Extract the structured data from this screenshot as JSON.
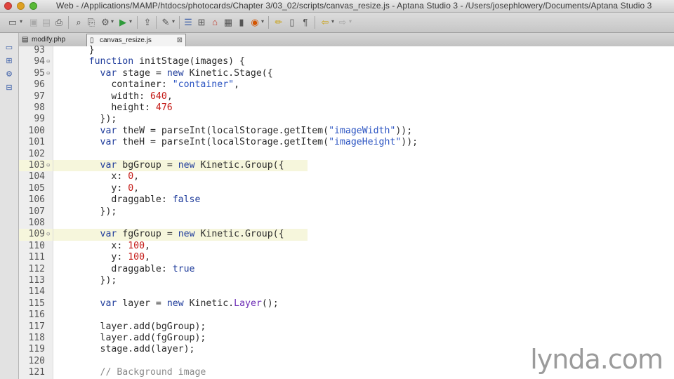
{
  "window": {
    "title": "Web - /Applications/MAMP/htdocs/photocards/Chapter 3/03_02/scripts/canvas_resize.js - Aptana Studio 3 - /Users/josephlowery/Documents/Aptana Studio 3"
  },
  "tabs": [
    {
      "label": "modify.php",
      "active": false
    },
    {
      "label": "canvas_resize.js",
      "active": true,
      "close": "⊠"
    }
  ],
  "toolbar": {
    "icons": [
      "new-file-icon",
      "save-icon",
      "save-all-icon",
      "print-icon",
      "search-icon",
      "publish-icon",
      "settings-gear-icon",
      "run-icon",
      "deploy-icon",
      "wand-icon",
      "outline-icon",
      "tree-icon",
      "home-icon",
      "image-icon",
      "terminal-icon",
      "color-wheel-icon",
      "pencil-icon",
      "file-icon",
      "pilcrow-icon",
      "back-arrow-icon",
      "forward-arrow-icon"
    ]
  },
  "editor": {
    "lines": [
      {
        "num": "93",
        "code": "      }"
      },
      {
        "num": "94",
        "code": "      function initStage(images) {",
        "fold": true
      },
      {
        "num": "95",
        "code": "        var stage = new Kinetic.Stage({",
        "fold": true
      },
      {
        "num": "96",
        "code": "          container: \"container\","
      },
      {
        "num": "97",
        "code": "          width: 640,"
      },
      {
        "num": "98",
        "code": "          height: 476"
      },
      {
        "num": "99",
        "code": "        });"
      },
      {
        "num": "100",
        "code": "        var theW = parseInt(localStorage.getItem(\"imageWidth\"));"
      },
      {
        "num": "101",
        "code": "        var theH = parseInt(localStorage.getItem(\"imageHeight\"));"
      },
      {
        "num": "102",
        "code": ""
      },
      {
        "num": "103",
        "code": "        var bgGroup = new Kinetic.Group({",
        "fold": true,
        "highlight": true
      },
      {
        "num": "104",
        "code": "          x: 0,"
      },
      {
        "num": "105",
        "code": "          y: 0,"
      },
      {
        "num": "106",
        "code": "          draggable: false"
      },
      {
        "num": "107",
        "code": "        });"
      },
      {
        "num": "108",
        "code": ""
      },
      {
        "num": "109",
        "code": "        var fgGroup = new Kinetic.Group({",
        "fold": true,
        "highlight": true
      },
      {
        "num": "110",
        "code": "          x: 100,"
      },
      {
        "num": "111",
        "code": "          y: 100,"
      },
      {
        "num": "112",
        "code": "          draggable: true"
      },
      {
        "num": "113",
        "code": "        });"
      },
      {
        "num": "114",
        "code": ""
      },
      {
        "num": "115",
        "code": "        var layer = new Kinetic.Layer();"
      },
      {
        "num": "116",
        "code": ""
      },
      {
        "num": "117",
        "code": "        layer.add(bgGroup);"
      },
      {
        "num": "118",
        "code": "        layer.add(fgGroup);"
      },
      {
        "num": "119",
        "code": "        stage.add(layer);"
      },
      {
        "num": "120",
        "code": ""
      },
      {
        "num": "121",
        "code": "        // Background image"
      }
    ]
  },
  "watermark": "lynda.com",
  "colors": {
    "keyword": "#1f3c9b",
    "string": "#2b54c2",
    "number": "#c41a16",
    "comment": "#8a8a8a",
    "highlight_line": "#f6f6dc"
  }
}
